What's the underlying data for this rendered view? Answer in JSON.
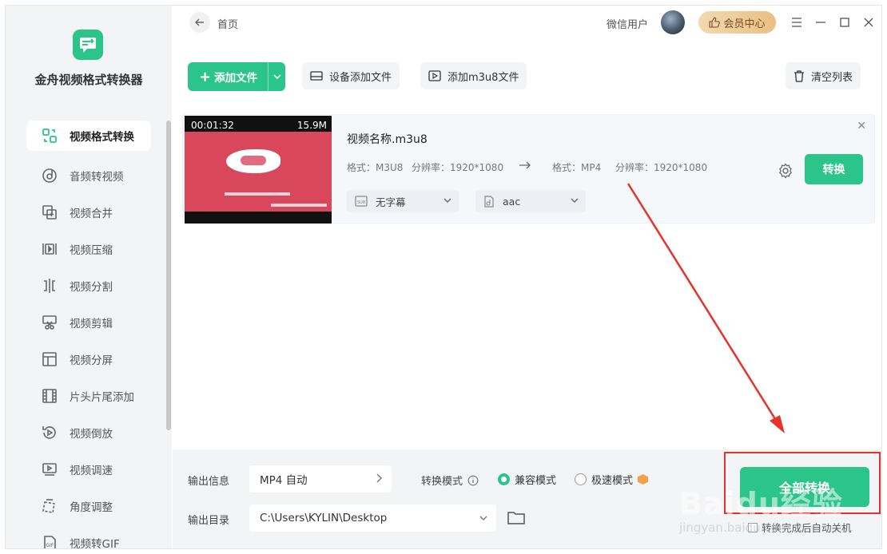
{
  "app": {
    "name": "金舟视频格式转换器"
  },
  "sidebar": {
    "items": [
      {
        "label": "视频格式转换",
        "icon": "convert-icon",
        "active": true
      },
      {
        "label": "音频转视频",
        "icon": "music-disc-icon"
      },
      {
        "label": "视频合并",
        "icon": "merge-icon"
      },
      {
        "label": "视频压缩",
        "icon": "compress-icon"
      },
      {
        "label": "视频分割",
        "icon": "split-icon"
      },
      {
        "label": "视频剪辑",
        "icon": "scissors-icon"
      },
      {
        "label": "视频分屏",
        "icon": "layout-icon"
      },
      {
        "label": "片头片尾添加",
        "icon": "film-icon"
      },
      {
        "label": "视频倒放",
        "icon": "rewind-icon"
      },
      {
        "label": "视频调速",
        "icon": "speed-icon"
      },
      {
        "label": "角度调整",
        "icon": "rotate-icon"
      },
      {
        "label": "视频转GIF",
        "icon": "gif-icon"
      }
    ]
  },
  "topbar": {
    "home": "首页",
    "user": "微信用户",
    "vip": "会员中心"
  },
  "toolbar": {
    "add_file": "添加文件",
    "device_add": "设备添加文件",
    "add_m3u8": "添加m3u8文件",
    "clear_list": "清空列表"
  },
  "file": {
    "duration": "00:01:32",
    "size": "15.9M",
    "name": "视频名称.m3u8",
    "src_format_label": "格式：M3U8",
    "src_res_label": "分辨率：1920*1080",
    "dst_format_label": "格式：MP4",
    "dst_res_label": "分辨率：1920*1080",
    "subtitle": "无字幕",
    "audio": "aac",
    "convert": "转换"
  },
  "bottom": {
    "output_info_label": "输出信息",
    "output_info_value": "MP4 自动",
    "mode_label": "转换模式",
    "mode_compat": "兼容模式",
    "mode_fast": "极速模式",
    "output_dir_label": "输出目录",
    "output_dir_value": "C:\\Users\\KYLIN\\Desktop",
    "convert_all": "全部转换",
    "auto_shutdown": "转换完成后自动关机"
  },
  "watermark": {
    "text": "Baidu经验",
    "sub": "jingyan.baidu.com"
  },
  "colors": {
    "accent": "#2bc48a",
    "annotation": "#e8322b",
    "vip": "#e9bf85"
  }
}
